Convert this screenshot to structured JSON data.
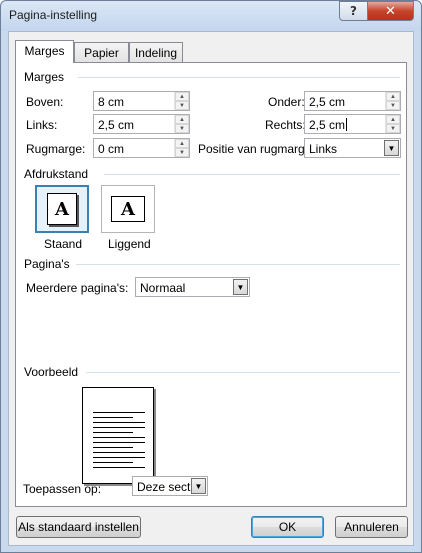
{
  "window": {
    "title": "Pagina-instelling",
    "help_glyph": "?",
    "close_glyph": "✕"
  },
  "tabs": [
    {
      "label": "Marges",
      "active": true
    },
    {
      "label": "Papier",
      "active": false
    },
    {
      "label": "Indeling",
      "active": false
    }
  ],
  "margins": {
    "group_label": "Marges",
    "top": {
      "label": "Boven:",
      "value": "8 cm"
    },
    "bottom": {
      "label": "Onder:",
      "value": "2,5 cm"
    },
    "left": {
      "label": "Links:",
      "value": "2,5 cm"
    },
    "right": {
      "label": "Rechts:",
      "value": "2,5 cm"
    },
    "gutter": {
      "label": "Rugmarge:",
      "value": "0 cm"
    },
    "gutter_position": {
      "label": "Positie van rugmarge:",
      "value": "Links"
    }
  },
  "orientation": {
    "group_label": "Afdrukstand",
    "portrait": {
      "label": "Staand",
      "glyph": "A",
      "selected": true
    },
    "landscape": {
      "label": "Liggend",
      "glyph": "A",
      "selected": false
    }
  },
  "pages": {
    "group_label": "Pagina's",
    "multiple": {
      "label": "Meerdere pagina's:",
      "value": "Normaal"
    }
  },
  "preview": {
    "group_label": "Voorbeeld"
  },
  "apply_to": {
    "label": "Toepassen op:",
    "value": "Deze sectie"
  },
  "buttons": {
    "set_default": "Als standaard instellen",
    "ok": "OK",
    "cancel": "Annuleren"
  },
  "icons": {
    "spin_up": "▲",
    "spin_down": "▼",
    "dropdown": "▼"
  },
  "colors": {
    "selection_border": "#3c7fb1",
    "close_red": "#c7432c",
    "frame": "#c9daee"
  }
}
